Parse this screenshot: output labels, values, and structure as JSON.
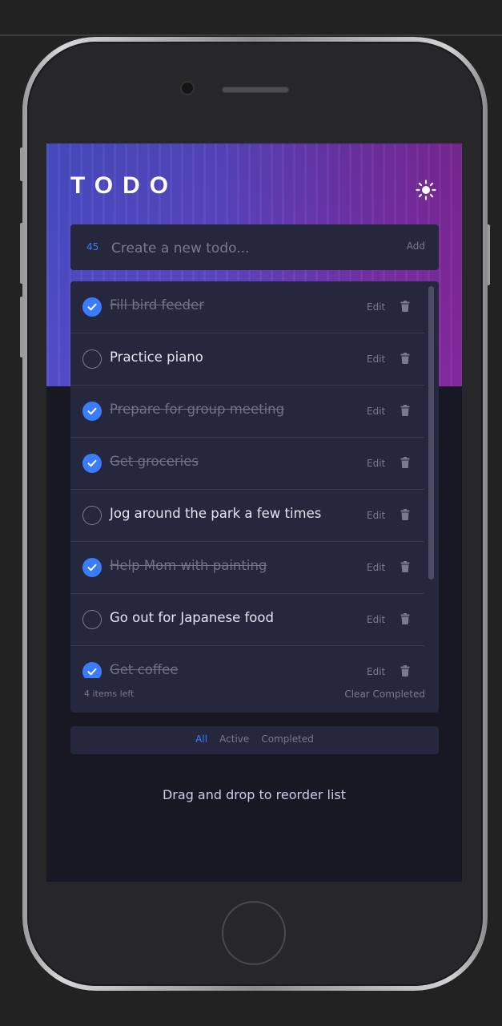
{
  "app": {
    "title": "TODO",
    "theme_toggle_icon": "sun-icon"
  },
  "new_todo": {
    "count": "45",
    "placeholder": "Create a new todo...",
    "add_label": "Add"
  },
  "todos": [
    {
      "text": "Fill bird feeder",
      "completed": true,
      "edit_label": "Edit"
    },
    {
      "text": "Practice piano",
      "completed": false,
      "edit_label": "Edit"
    },
    {
      "text": "Prepare for group meeting",
      "completed": true,
      "edit_label": "Edit"
    },
    {
      "text": "Get groceries",
      "completed": true,
      "edit_label": "Edit"
    },
    {
      "text": "Jog around the park a few times",
      "completed": false,
      "edit_label": "Edit"
    },
    {
      "text": "Help Mom with painting",
      "completed": true,
      "edit_label": "Edit"
    },
    {
      "text": "Go out for Japanese food",
      "completed": false,
      "edit_label": "Edit"
    },
    {
      "text": "Get coffee",
      "completed": true,
      "edit_label": "Edit"
    }
  ],
  "footer": {
    "items_left": "4 items left",
    "clear_completed": "Clear Completed"
  },
  "filters": {
    "all": "All",
    "active": "Active",
    "completed": "Completed",
    "selected": "All"
  },
  "hint": "Drag and drop to reorder list",
  "colors": {
    "accent": "#3a7cfd",
    "card": "#25273c",
    "background": "#181824"
  }
}
